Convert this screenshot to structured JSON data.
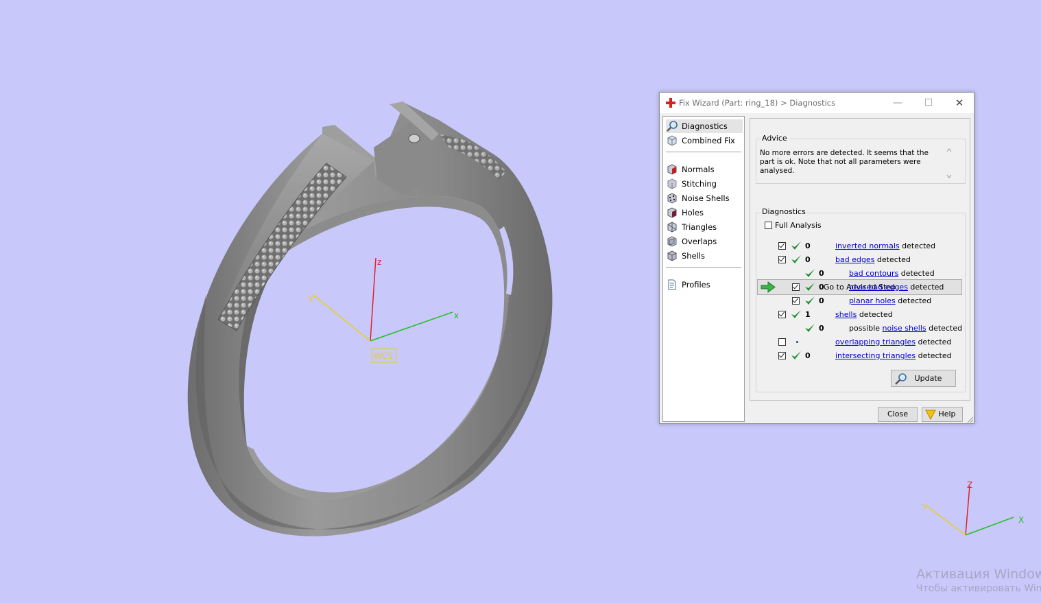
{
  "viewport": {
    "wcs_label": "WCS",
    "axes": {
      "x": "x",
      "y": "y",
      "z": "z"
    },
    "corner_axes": {
      "x": "X",
      "y": "Y",
      "z": "Z"
    },
    "background_color": "#c8c8fa",
    "model_color": "#7e7e7e"
  },
  "watermark": {
    "line1": "Активация Windows",
    "line2": "Чтобы активировать Wind"
  },
  "dialog": {
    "title": "Fix Wizard (Part: ring_18) > Diagnostics",
    "nav": {
      "items_top": [
        {
          "label": "Diagnostics",
          "icon": "magnifier-icon"
        },
        {
          "label": "Combined Fix",
          "icon": "cube-icon"
        }
      ],
      "items_mid": [
        {
          "label": "Normals",
          "icon": "normals-cube-icon"
        },
        {
          "label": "Stitching",
          "icon": "stitching-cube-icon"
        },
        {
          "label": "Noise Shells",
          "icon": "noise-shells-icon"
        },
        {
          "label": "Holes",
          "icon": "holes-cube-icon"
        },
        {
          "label": "Triangles",
          "icon": "triangles-cube-icon"
        },
        {
          "label": "Overlaps",
          "icon": "overlaps-cube-icon"
        },
        {
          "label": "Shells",
          "icon": "shells-cube-icon"
        }
      ],
      "items_bottom": [
        {
          "label": "Profiles",
          "icon": "document-icon"
        }
      ]
    },
    "advice": {
      "group_title": "Advice",
      "text": "No more errors are detected. It seems that the part is ok. Note that not all parameters were analysed."
    },
    "advised_button": "Go to Advised Step",
    "diagnostics": {
      "group_title": "Diagnostics",
      "full_analysis_label": "Full Analysis",
      "rows": [
        {
          "count": "0",
          "link": "inverted normals",
          "suffix": " detected"
        },
        {
          "count": "0",
          "link": "bad edges",
          "suffix": " detected"
        },
        {
          "count": "0",
          "link": "bad contours",
          "suffix": " detected"
        },
        {
          "count": "0",
          "link": "near bad edges",
          "suffix": " detected"
        },
        {
          "count": "0",
          "link": "planar holes",
          "suffix": " detected"
        },
        {
          "count": "1",
          "link": "shells",
          "suffix": " detected"
        },
        {
          "count": "0",
          "prefix": "possible ",
          "link": "noise shells",
          "suffix": " detected"
        },
        {
          "count": "",
          "link": "overlapping triangles",
          "suffix": " detected"
        },
        {
          "count": "0",
          "link": "intersecting triangles",
          "suffix": " detected"
        }
      ],
      "update_label": "Update"
    },
    "close_label": "Close",
    "help_label": "Help"
  }
}
